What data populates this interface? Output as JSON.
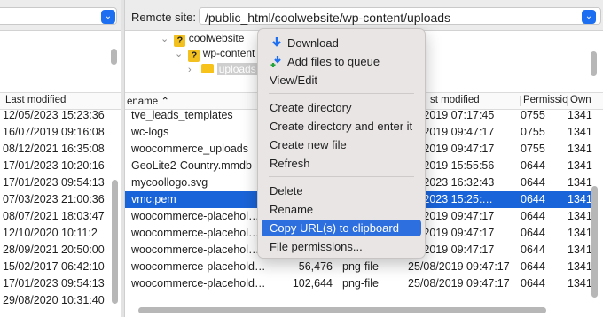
{
  "remote_bar": {
    "label": "Remote site:",
    "path": "/public_html/coolwebsite/wp-content/uploads"
  },
  "tree": [
    {
      "label": "coolwebsite",
      "icon": "question-folder-icon"
    },
    {
      "label": "wp-content",
      "icon": "question-folder-icon"
    },
    {
      "label": "uploads",
      "icon": "folder-icon"
    }
  ],
  "local": {
    "header": "Last modified",
    "rows": [
      "12/05/2023 15:23:36",
      "16/07/2019 09:16:08",
      "08/12/2021 16:35:08",
      "17/01/2023 10:20:16",
      "17/01/2023 09:54:13",
      "07/03/2023 21:00:36",
      "08/07/2021 18:03:47",
      "12/10/2020 10:11:2",
      "28/09/2021 20:50:00",
      "15/02/2017 06:42:10",
      "17/01/2023 09:54:13",
      "29/08/2020 10:31:40"
    ]
  },
  "remote": {
    "headers": {
      "name": "ename",
      "modified": "st modified",
      "perm": "Permissio",
      "owner": "Own"
    },
    "rows": [
      {
        "name": "tve_leads_templates",
        "size": "",
        "type": "",
        "mod": "07/2019 07:17:45",
        "perm": "0755",
        "own": "1341"
      },
      {
        "name": "wc-logs",
        "size": "",
        "type": "",
        "mod": "08/2019 09:47:17",
        "perm": "0755",
        "own": "1341"
      },
      {
        "name": "woocommerce_uploads",
        "size": "",
        "type": "",
        "mod": "08/2019 09:47:17",
        "perm": "0755",
        "own": "1341"
      },
      {
        "name": "GeoLite2-Country.mmdb",
        "size": "",
        "type": "",
        "mod": "09/2019 15:55:56",
        "perm": "0644",
        "own": "1341"
      },
      {
        "name": "mycoollogo.svg",
        "size": "",
        "type": "",
        "mod": "05/2023 16:32:43",
        "perm": "0644",
        "own": "1341"
      },
      {
        "name": "vmc.pem",
        "size": "",
        "type": "",
        "mod": "05/2023 15:25:…",
        "perm": "0644",
        "own": "1341"
      },
      {
        "name": "woocommerce-placehol…",
        "size": "",
        "type": "",
        "mod": "08/2019 09:47:17",
        "perm": "0644",
        "own": "1341"
      },
      {
        "name": "woocommerce-placehol…",
        "size": "",
        "type": "",
        "mod": "08/2019 09:47:17",
        "perm": "0644",
        "own": "1341"
      },
      {
        "name": "woocommerce-placehol…",
        "size": "",
        "type": "",
        "mod": "08/2019 09:47:17",
        "perm": "0644",
        "own": "1341"
      },
      {
        "name": "woocommerce-placehold…",
        "size": "56,476",
        "type": "png-file",
        "mod": "25/08/2019 09:47:17",
        "perm": "0644",
        "own": "1341"
      },
      {
        "name": "woocommerce-placehold…",
        "size": "102,644",
        "type": "png-file",
        "mod": "25/08/2019 09:47:17",
        "perm": "0644",
        "own": "1341"
      }
    ],
    "selected_index": 5
  },
  "context_menu": {
    "items": [
      {
        "label": "Download",
        "icon": "download-arrow-icon"
      },
      {
        "label": "Add files to queue",
        "icon": "add-to-queue-icon"
      },
      {
        "label": "View/Edit"
      },
      {
        "label": "Create directory"
      },
      {
        "label": "Create directory and enter it"
      },
      {
        "label": "Create new file"
      },
      {
        "label": "Refresh"
      },
      {
        "label": "Delete"
      },
      {
        "label": "Rename"
      },
      {
        "label": "Copy URL(s) to clipboard",
        "highlighted": true
      },
      {
        "label": "File permissions..."
      }
    ]
  },
  "colors": {
    "selection": "#1a64d9",
    "menu_highlight": "#2d6fdf",
    "folder": "#f7c21a",
    "select_button": "#1d6ff2"
  }
}
